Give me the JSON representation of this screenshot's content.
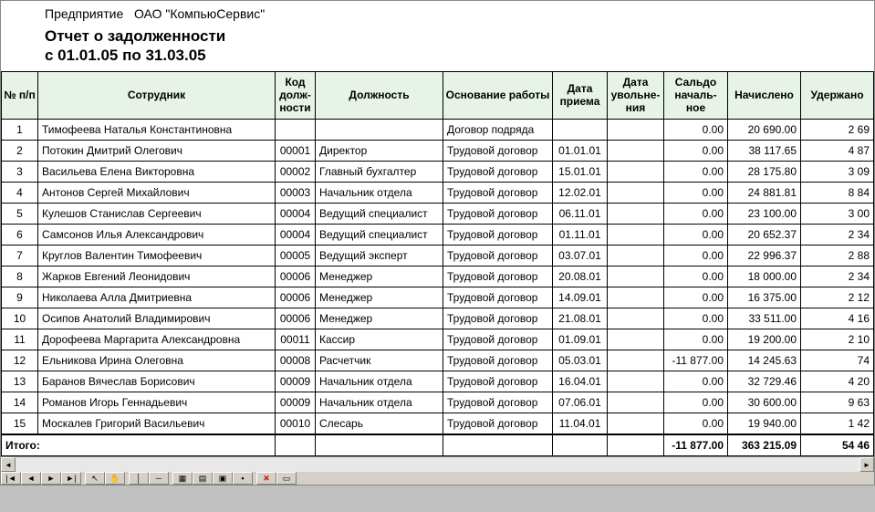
{
  "header": {
    "enterprise_label": "Предприятие",
    "enterprise_name": "ОАО \"КомпьюСервис\"",
    "report_title": "Отчет о задолженности",
    "period": "с 01.01.05 по 31.03.05"
  },
  "columns": {
    "num": "№ п/п",
    "employee": "Сотрудник",
    "code": "Код долж-ности",
    "position": "Должность",
    "basis": "Основание работы",
    "hire": "Дата приема",
    "fire": "Дата увольне-ния",
    "opening": "Сальдо началь-ное",
    "accrued": "Начислено",
    "withheld": "Удержано"
  },
  "rows": [
    {
      "n": "1",
      "emp": "Тимофеева Наталья Константиновна",
      "code": "",
      "pos": "",
      "basis": "Договор подряда",
      "hire": "",
      "fire": "",
      "open": "0.00",
      "acc": "20 690.00",
      "wh": "2 69"
    },
    {
      "n": "2",
      "emp": "Потокин Дмитрий Олегович",
      "code": "00001",
      "pos": "Директор",
      "basis": "Трудовой договор",
      "hire": "01.01.01",
      "fire": "",
      "open": "0.00",
      "acc": "38 117.65",
      "wh": "4 87"
    },
    {
      "n": "3",
      "emp": "Васильева Елена Викторовна",
      "code": "00002",
      "pos": "Главный бухгалтер",
      "basis": "Трудовой договор",
      "hire": "15.01.01",
      "fire": "",
      "open": "0.00",
      "acc": "28 175.80",
      "wh": "3 09"
    },
    {
      "n": "4",
      "emp": "Антонов Сергей Михайлович",
      "code": "00003",
      "pos": "Начальник отдела",
      "basis": "Трудовой договор",
      "hire": "12.02.01",
      "fire": "",
      "open": "0.00",
      "acc": "24 881.81",
      "wh": "8 84"
    },
    {
      "n": "5",
      "emp": "Кулешов Станислав Сергеевич",
      "code": "00004",
      "pos": "Ведущий специалист",
      "basis": "Трудовой договор",
      "hire": "06.11.01",
      "fire": "",
      "open": "0.00",
      "acc": "23 100.00",
      "wh": "3 00"
    },
    {
      "n": "6",
      "emp": "Самсонов Илья Александрович",
      "code": "00004",
      "pos": "Ведущий специалист",
      "basis": "Трудовой договор",
      "hire": "01.11.01",
      "fire": "",
      "open": "0.00",
      "acc": "20 652.37",
      "wh": "2 34"
    },
    {
      "n": "7",
      "emp": "Круглов Валентин Тимофеевич",
      "code": "00005",
      "pos": "Ведущий эксперт",
      "basis": "Трудовой договор",
      "hire": "03.07.01",
      "fire": "",
      "open": "0.00",
      "acc": "22 996.37",
      "wh": "2 88"
    },
    {
      "n": "8",
      "emp": "Жарков Евгений Леонидович",
      "code": "00006",
      "pos": "Менеджер",
      "basis": "Трудовой договор",
      "hire": "20.08.01",
      "fire": "",
      "open": "0.00",
      "acc": "18 000.00",
      "wh": "2 34"
    },
    {
      "n": "9",
      "emp": "Николаева Алла Дмитриевна",
      "code": "00006",
      "pos": "Менеджер",
      "basis": "Трудовой договор",
      "hire": "14.09.01",
      "fire": "",
      "open": "0.00",
      "acc": "16 375.00",
      "wh": "2 12"
    },
    {
      "n": "10",
      "emp": "Осипов Анатолий Владимирович",
      "code": "00006",
      "pos": "Менеджер",
      "basis": "Трудовой договор",
      "hire": "21.08.01",
      "fire": "",
      "open": "0.00",
      "acc": "33 511.00",
      "wh": "4 16"
    },
    {
      "n": "11",
      "emp": "Дорофеева Маргарита Александровна",
      "code": "00011",
      "pos": "Кассир",
      "basis": "Трудовой договор",
      "hire": "01.09.01",
      "fire": "",
      "open": "0.00",
      "acc": "19 200.00",
      "wh": "2 10"
    },
    {
      "n": "12",
      "emp": "Ельникова Ирина Олеговна",
      "code": "00008",
      "pos": "Расчетчик",
      "basis": "Трудовой договор",
      "hire": "05.03.01",
      "fire": "",
      "open": "-11 877.00",
      "acc": "14 245.63",
      "wh": "74"
    },
    {
      "n": "13",
      "emp": "Баранов Вячеслав Борисович",
      "code": "00009",
      "pos": "Начальник отдела",
      "basis": "Трудовой договор",
      "hire": "16.04.01",
      "fire": "",
      "open": "0.00",
      "acc": "32 729.46",
      "wh": "4 20"
    },
    {
      "n": "14",
      "emp": "Романов Игорь Геннадьевич",
      "code": "00009",
      "pos": "Начальник отдела",
      "basis": "Трудовой договор",
      "hire": "07.06.01",
      "fire": "",
      "open": "0.00",
      "acc": "30 600.00",
      "wh": "9 63"
    },
    {
      "n": "15",
      "emp": "Москалев Григорий Васильевич",
      "code": "00010",
      "pos": "Слесарь",
      "basis": "Трудовой договор",
      "hire": "11.04.01",
      "fire": "",
      "open": "0.00",
      "acc": "19 940.00",
      "wh": "1 42"
    }
  ],
  "totals": {
    "label": "Итого:",
    "open": "-11 877.00",
    "acc": "363 215.09",
    "wh": "54 46"
  },
  "toolbar": {
    "icons": [
      "first",
      "prev",
      "next",
      "last",
      "sep",
      "cursor",
      "hand",
      "sep",
      "vline",
      "hline",
      "sep",
      "grid",
      "table",
      "props",
      "sep",
      "sep",
      "cancel",
      "check"
    ]
  }
}
